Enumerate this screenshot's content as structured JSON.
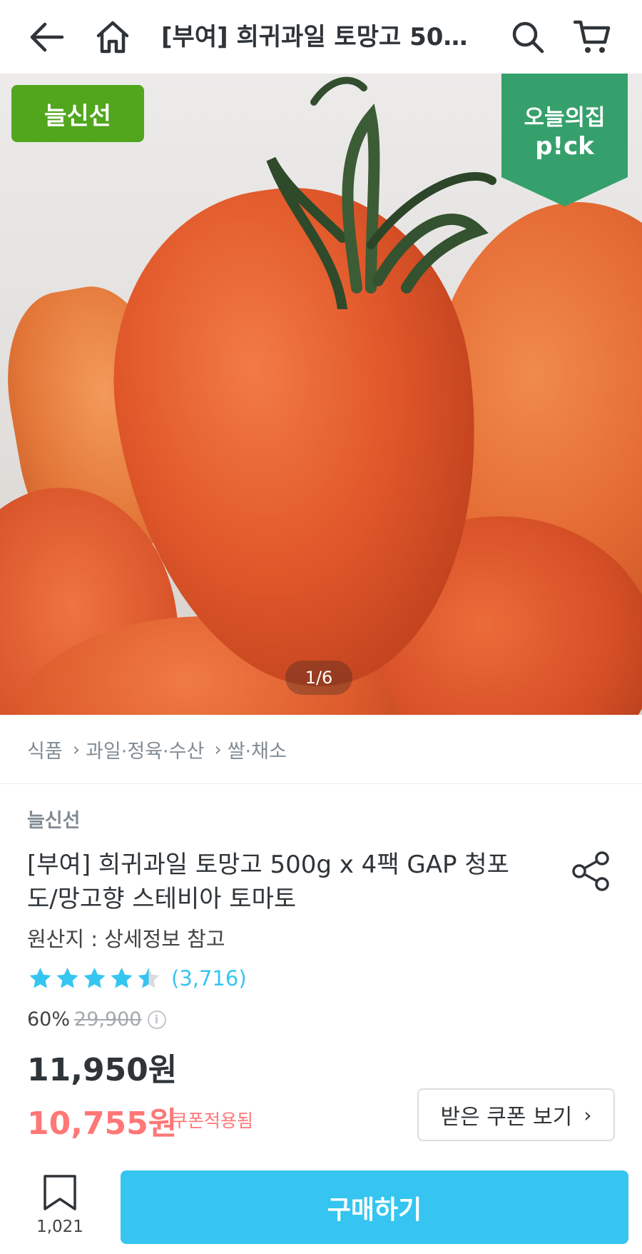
{
  "header": {
    "title": "[부여] 희귀과일 토망고 500g x 4팩 GAP 청포도/망고향 스테비아 토마토",
    "back_icon": "arrow-left-icon",
    "home_icon": "home-icon",
    "search_icon": "search-icon",
    "cart_icon": "cart-icon"
  },
  "hero": {
    "badge_fresh": "늘신선",
    "badge_pick_line1": "오늘의집",
    "badge_pick_line2": "p!ck",
    "pager": "1/6",
    "badge_fresh_color": "#51a61e",
    "badge_pick_color": "#35a06b"
  },
  "breadcrumb": {
    "items": [
      "식품",
      "과일·정육·수산",
      "쌀·채소"
    ]
  },
  "product": {
    "brand": "늘신선",
    "title": "[부여] 희귀과일 토망고 500g x 4팩 GAP 청포도/망고향 스테비아 토마토",
    "origin": "원산지 : 상세정보 참고",
    "rating": 4.5,
    "review_count": "(3,716)",
    "discount_rate": "60%",
    "original_price": "29,900",
    "price": "11,950원",
    "coupon_price": "10,755원",
    "coupon_label": "쿠폰적용됨",
    "coupon_button": "받은 쿠폰 보기"
  },
  "bottom_bar": {
    "bookmark_count": "1,021",
    "buy_button": "구매하기"
  },
  "colors": {
    "accent": "#35c5f0",
    "coupon": "#f77"
  }
}
